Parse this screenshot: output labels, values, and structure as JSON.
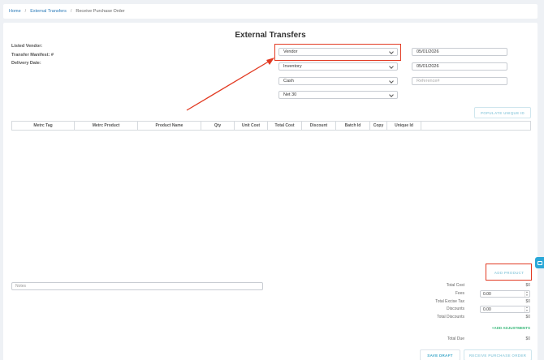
{
  "breadcrumb": {
    "home": "Home",
    "section": "External Transfers",
    "current": "Receive Purchase Order",
    "separator": "/"
  },
  "page": {
    "title": "External Transfers"
  },
  "meta": {
    "listed_vendor": "Listed Vendor:",
    "transfer_manifest": "Transfer Manifest: #",
    "delivery_date": "Delivery Date:"
  },
  "form": {
    "vendor": "Vendor",
    "inventory": "Inventory",
    "payment": "Cash",
    "terms": "Net 30",
    "date1": "05/01/2026",
    "date2": "05/01/2026",
    "reference_placeholder": "Reference#"
  },
  "buttons": {
    "populate_unique_id": "POPULATE UNIQUE ID",
    "add_product": "ADD PRODUCT",
    "save_draft": "SAVE DRAFT",
    "receive_po": "RECEIVE PURCHASE ORDER",
    "add_adjustments": "+ADD ADJUSTMENTS"
  },
  "table": {
    "columns": [
      "Metrc Tag",
      "Metrc Product",
      "Product Name",
      "Qty",
      "Unit Cost",
      "Total Cost",
      "Discount",
      "Batch Id",
      "Copy",
      "Unique Id",
      ""
    ]
  },
  "notes": {
    "placeholder": "Notes"
  },
  "totals": {
    "total_cost_label": "Total Cost",
    "total_cost": "$0",
    "fees_label": "Fees",
    "fees_value": "0.00",
    "excise_label": "Total Excise Tax",
    "excise_value": "$0",
    "discounts_label": "Discounts",
    "discounts_value": "0.00",
    "total_discounts_label": "Total Discounts",
    "total_discounts_value": "$0",
    "total_due_label": "Total Due",
    "total_due_value": "$0"
  },
  "colors": {
    "highlight": "#e23a22",
    "link": "#2a7ab8",
    "accent": "#3aa6c8",
    "adjustments": "#3ab87a"
  }
}
